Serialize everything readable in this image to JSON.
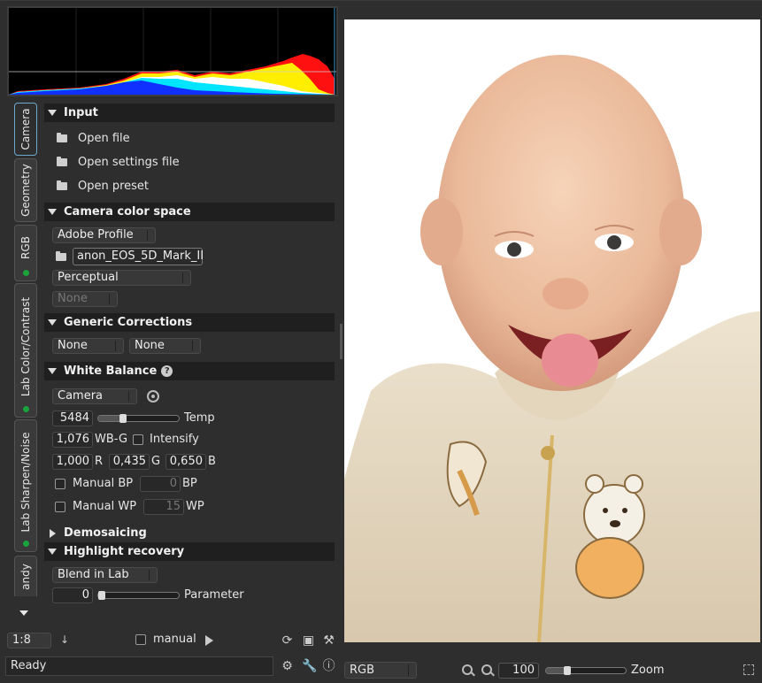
{
  "tabs": [
    {
      "label": "Camera",
      "active": true,
      "indicator": false
    },
    {
      "label": "Geometry",
      "active": false,
      "indicator": false
    },
    {
      "label": "RGB",
      "active": false,
      "indicator": true
    },
    {
      "label": "Lab Color/Contrast",
      "active": false,
      "indicator": true
    },
    {
      "label": "Lab Sharpen/Noise",
      "active": false,
      "indicator": true
    },
    {
      "label": "andy",
      "active": false,
      "indicator": false
    }
  ],
  "input": {
    "title": "Input",
    "open_file": "Open file",
    "open_settings": "Open settings file",
    "open_preset": "Open preset"
  },
  "camera_color_space": {
    "title": "Camera color space",
    "profile": "Adobe Profile",
    "profile_file": "anon_EOS_5D_Mark_II",
    "intent": "Perceptual",
    "extra": "None"
  },
  "generic_corrections": {
    "title": "Generic Corrections",
    "left": "None",
    "right": "None"
  },
  "white_balance": {
    "title": "White Balance",
    "help": "?",
    "mode": "Camera",
    "temp_value": "5484",
    "temp_label": "Temp",
    "wbg_value": "1,076",
    "wbg_label": "WB-G",
    "intensify_label": "Intensify",
    "r_value": "1,000",
    "r_label": "R",
    "g_value": "0,435",
    "g_label": "G",
    "b_value": "0,650",
    "b_label": "B",
    "manual_bp_label": "Manual BP",
    "bp_value": "0",
    "bp_label": "BP",
    "manual_wp_label": "Manual WP",
    "wp_value": "15",
    "wp_label": "WP"
  },
  "demosaicing": {
    "title": "Demosaicing"
  },
  "highlight_recovery": {
    "title": "Highlight recovery",
    "mode": "Blend in Lab",
    "param_value": "0",
    "param_label": "Parameter"
  },
  "bottom_left": {
    "zoom_ratio": "1:8",
    "manual_label": "manual",
    "status": "Ready"
  },
  "bottom_right": {
    "channel": "RGB",
    "zoom_value": "100",
    "zoom_label": "Zoom"
  },
  "colors": {
    "accent": "#6aa9c9",
    "indicator_green": "#19a33a",
    "panel_bg": "#2e2e2e",
    "header_bg": "#1f1f1f"
  }
}
